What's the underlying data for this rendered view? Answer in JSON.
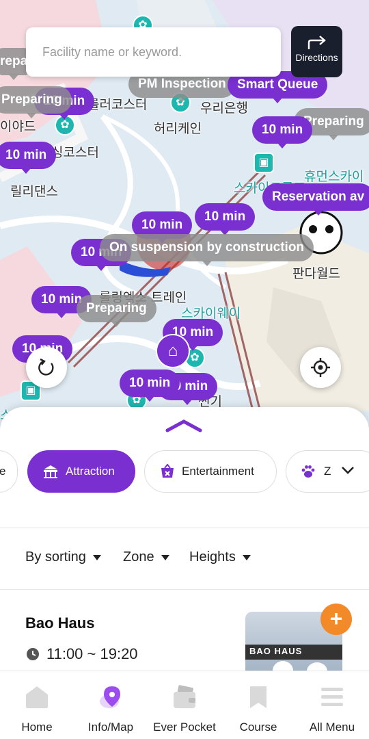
{
  "search": {
    "placeholder": "Facility name or keyword."
  },
  "directions": {
    "label": "Directions",
    "icon": "arrow-turn-right-icon"
  },
  "map": {
    "pills": [
      {
        "text": "10 min",
        "style": "purple"
      },
      {
        "text": "Preparing",
        "style": "gray"
      },
      {
        "text": "PM Inspection",
        "style": "gray"
      },
      {
        "text": "Smart Queue",
        "style": "purple"
      },
      {
        "text": "Preparing",
        "style": "purple"
      },
      {
        "text": "10 min",
        "style": "purple"
      },
      {
        "text": "10 min",
        "style": "purple"
      },
      {
        "text": "Preparing",
        "style": "gray"
      },
      {
        "text": "Reservation av",
        "style": "purple"
      },
      {
        "text": "10 min",
        "style": "purple"
      },
      {
        "text": "10 min",
        "style": "purple"
      },
      {
        "text": "10 min",
        "style": "purple"
      },
      {
        "text": "On suspension by construction",
        "style": "gray"
      },
      {
        "text": "10 min",
        "style": "purple"
      },
      {
        "text": "Preparing",
        "style": "gray"
      },
      {
        "text": "10 min",
        "style": "purple"
      },
      {
        "text": "10 min",
        "style": "purple"
      },
      {
        "text": "10 min",
        "style": "purple"
      },
      {
        "text": "10 min",
        "style": "purple"
      },
      {
        "text": "repa",
        "style": "gray"
      }
    ],
    "labels": [
      "롤러코스터",
      "우리은행",
      "이야드",
      "허리케인",
      "싱코스터",
      "휴먼스카이",
      "릴리댄스",
      "스카이크루즈",
      "판다월드",
      "롤링엑스 트레인",
      "스카이웨이",
      "스카이",
      "썬기"
    ]
  },
  "sheet": {
    "categories": [
      {
        "label": "e",
        "icon": "",
        "active": false
      },
      {
        "label": "Attraction",
        "icon": "carousel-icon",
        "active": true
      },
      {
        "label": "Entertainment",
        "icon": "performance-icon",
        "active": false
      },
      {
        "label": "Z",
        "icon": "paw-icon",
        "active": false
      }
    ],
    "filters": [
      "By sorting",
      "Zone",
      "Heights"
    ],
    "item": {
      "title": "Bao Haus",
      "hours": "11:00 ~ 19:20",
      "thumb_text": "BAO HAUS"
    }
  },
  "tabbar": [
    {
      "label": "Home",
      "icon": "home-icon"
    },
    {
      "label": "Info/Map",
      "icon": "map-pin-icon"
    },
    {
      "label": "Ever Pocket",
      "icon": "wallet-icon"
    },
    {
      "label": "Course",
      "icon": "bookmark-icon"
    },
    {
      "label": "All Menu",
      "icon": "menu-icon"
    }
  ],
  "colors": {
    "accent": "#7a2fd1",
    "dark": "#1a1f2e",
    "orange": "#f38a2a"
  }
}
